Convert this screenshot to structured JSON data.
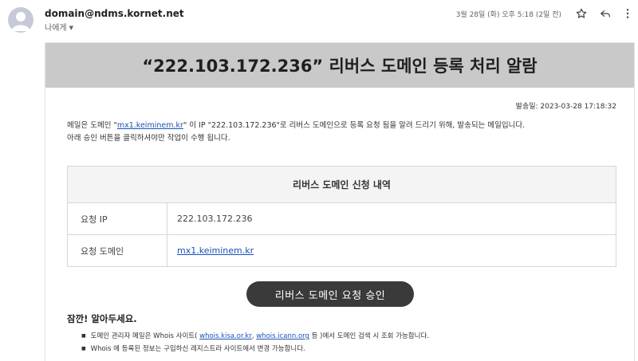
{
  "email": {
    "sender": "domain@ndms.kornet.net",
    "recipient_label": "나에게",
    "date": "3월 28일 (화) 오후 5:18 (2일 전)"
  },
  "icons": {
    "avatar": "person-avatar-icon",
    "star": "star-icon",
    "reply": "reply-icon",
    "more": "more-vert-icon"
  },
  "body": {
    "title": "“222.103.172.236” 리버스 도메인 등록 처리 알람",
    "sent_label": "발송일: 2023-03-28 17:18:32",
    "intro": {
      "part1": "메일은 도메인 \"",
      "domain_link": "mx1.keiminem.kr",
      "part2": "\" 이 IP \"222.103.172.236\"로 리버스 도메인으로 등록 요청 됨을 알려 드리기 위해, 발송되는 메일입니다.",
      "line2": "아래 승인 버튼을 클릭하셔야만 작업이 수행 됩니다."
    },
    "request_table": {
      "header": "리버스 도메인 신청 내역",
      "rows": [
        {
          "label": "요청 IP",
          "value": "222.103.172.236"
        },
        {
          "label": "요청 도메인",
          "value": "mx1.keiminem.kr"
        }
      ]
    },
    "approve_button": "리버스 도메인 요청 승인",
    "notice_title": "잠깐! 알아두세요.",
    "notes": {
      "n1_part1": "도메인 관리자 메일은 Whois 사이트( ",
      "n1_link1": "whois.kisa.or.kr",
      "n1_sep": ", ",
      "n1_link2": "whois.icann.org",
      "n1_part2": " 등 )에서 도메인 검색 시 조회 가능합니다.",
      "n2": "Whois 에 등록된 정보는 구입하신 레지스트라 사이트에서 변경 가능합니다."
    }
  }
}
